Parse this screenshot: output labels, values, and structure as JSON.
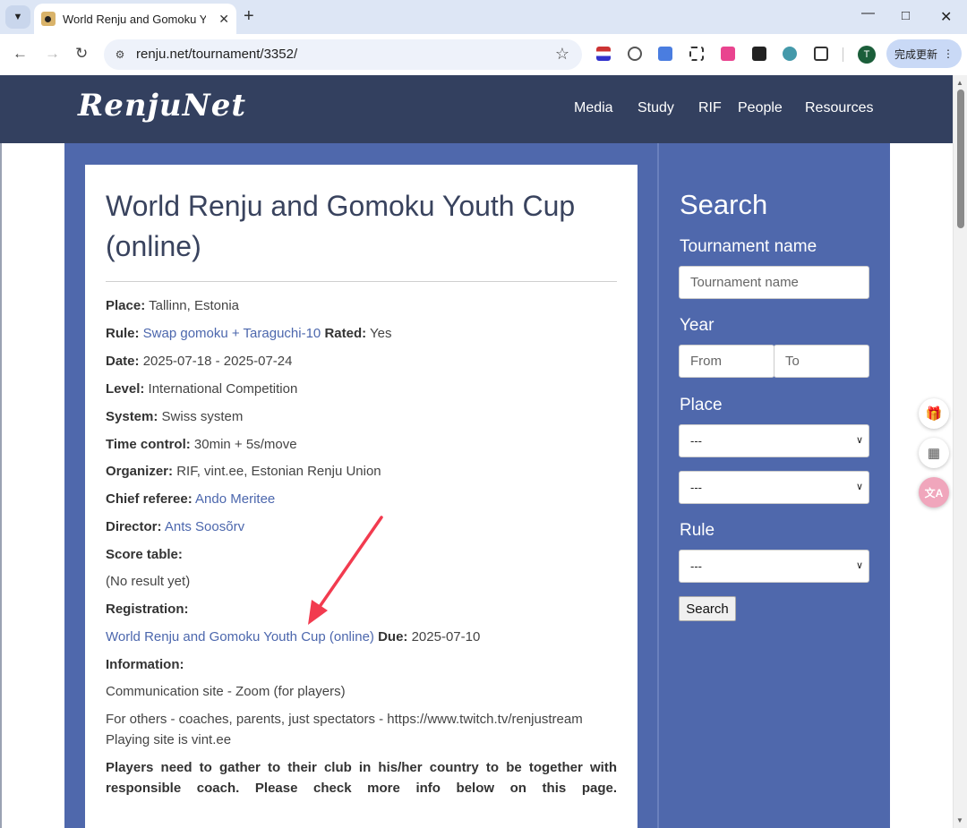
{
  "browser": {
    "tab_title": "World Renju and Gomoku Yo",
    "url": "renju.net/tournament/3352/",
    "update_button": "完成更新",
    "profile_initial": "T",
    "icons": [
      "tab-dropdown-icon",
      "tab-close-icon",
      "new-tab-icon",
      "minimize-icon",
      "maximize-icon",
      "close-window-icon",
      "back-icon",
      "forward-icon",
      "reload-icon",
      "site-info-icon",
      "bookmark-star-icon",
      "menu-dots-icon"
    ]
  },
  "site": {
    "logo": "RenjuNet",
    "nav": [
      "Media",
      "Study",
      "RIF",
      "People",
      "Resources"
    ],
    "header_color": "#33405f",
    "accent_color": "#4f68ac",
    "link_color": "#4c67ad"
  },
  "tournament": {
    "title": "World Renju and Gomoku Youth Cup (online)",
    "place_label": "Place:",
    "place": "Tallinn, Estonia",
    "rule_label": "Rule:",
    "rule": "Swap gomoku + Taraguchi-10",
    "rated_label": "Rated:",
    "rated": "Yes",
    "date_label": "Date:",
    "date": "2025-07-18 - 2025-07-24",
    "level_label": "Level:",
    "level": "International Competition",
    "system_label": "System:",
    "system": "Swiss system",
    "time_control_label": "Time control:",
    "time_control": "30min + 5s/move",
    "organizer_label": "Organizer:",
    "organizer": "RIF, vint.ee, Estonian Renju Union",
    "chief_referee_label": "Chief referee:",
    "chief_referee": "Ando Meritee",
    "director_label": "Director:",
    "director": "Ants Soosõrv",
    "score_table_label": "Score table:",
    "score_table": "(No result yet)",
    "registration_label": "Registration:",
    "registration_link": "World Renju and Gomoku Youth Cup (online)",
    "due_label": "Due:",
    "due": "2025-07-10",
    "information_label": "Information:",
    "info_line1": "Communication site - Zoom (for players)",
    "info_line2": "For others - coaches, parents, just spectators - https://www.twitch.tv/renjustream",
    "info_line3": "Playing site is vint.ee",
    "info_note": "Players need to gather to their club in his/her country to be together with responsible coach. Please check more info below on this page."
  },
  "sidebar": {
    "title": "Search",
    "tournament_name_label": "Tournament name",
    "tournament_name_placeholder": "Tournament name",
    "year_label": "Year",
    "year_from_placeholder": "From",
    "year_to_placeholder": "To",
    "place_label": "Place",
    "place_select_1": "---",
    "place_select_2": "---",
    "rule_label": "Rule",
    "rule_select": "---",
    "search_button": "Search"
  }
}
